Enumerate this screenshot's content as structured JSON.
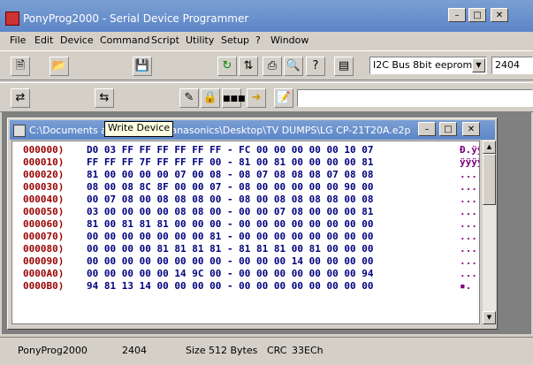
{
  "window": {
    "title": "PonyProg2000 - Serial Device Programmer",
    "min_glyph": "–",
    "max_glyph": "□",
    "close_glyph": "✕"
  },
  "menu": [
    "File",
    "Edit",
    "Device",
    "Command",
    "Script",
    "Utility",
    "Setup",
    "?",
    "Window"
  ],
  "toolbar1": {
    "device_family": "I2C Bus 8bit eeprom",
    "device_type": "2404"
  },
  "tooltip": "Write Device",
  "child": {
    "title": "C:\\Documents and Settings\\Panasonics\\Desktop\\TV DUMPS\\LG CP-21T20A.e2p"
  },
  "hex_rows": [
    {
      "addr": "000000)",
      "bytes": "D0 03 FF FF FF FF FF FF - FC 00 00 00 00 00 10 07",
      "ascii": "Ð.ÿÿ"
    },
    {
      "addr": "000010)",
      "bytes": "FF FF FF 7F FF FF FF 00 - 81 00 81 00 00 00 00 81",
      "ascii": "ÿÿÿÿ"
    },
    {
      "addr": "000020)",
      "bytes": "81 00 00 00 00 07 00 08 - 08 07 08 08 08 07 08 08",
      "ascii": "..."
    },
    {
      "addr": "000030)",
      "bytes": "08 00 08 8C 8F 00 00 07 - 08 00 00 00 00 00 90 00",
      "ascii": "..."
    },
    {
      "addr": "000040)",
      "bytes": "00 07 08 00 08 08 08 00 - 08 00 08 08 08 08 00 08",
      "ascii": "..."
    },
    {
      "addr": "000050)",
      "bytes": "03 00 00 00 00 08 08 00 - 00 00 07 08 00 00 00 81",
      "ascii": "..."
    },
    {
      "addr": "000060)",
      "bytes": "81 00 81 81 81 00 00 00 - 00 00 00 00 00 00 00 00",
      "ascii": "..."
    },
    {
      "addr": "000070)",
      "bytes": "00 00 00 00 00 00 00 81 - 00 00 00 00 00 00 00 00",
      "ascii": "..."
    },
    {
      "addr": "000080)",
      "bytes": "00 00 00 00 81 81 81 81 - 81 81 81 00 81 00 00 00",
      "ascii": "..."
    },
    {
      "addr": "000090)",
      "bytes": "00 00 00 00 00 00 00 00 - 00 00 00 14 00 00 00 00",
      "ascii": "..."
    },
    {
      "addr": "0000A0)",
      "bytes": "00 00 00 00 00 14 9C 00 - 00 00 00 00 00 00 00 94",
      "ascii": "..."
    },
    {
      "addr": "0000B0)",
      "bytes": "94 81 13 14 00 00 00 00 - 00 00 00 00 00 00 00 00",
      "ascii": "▪."
    }
  ],
  "status": {
    "app": "PonyProg2000",
    "device": "2404",
    "size_label": "Size",
    "size_value": "512 Bytes",
    "crc_label": "CRC",
    "crc_value": "33ECh"
  }
}
